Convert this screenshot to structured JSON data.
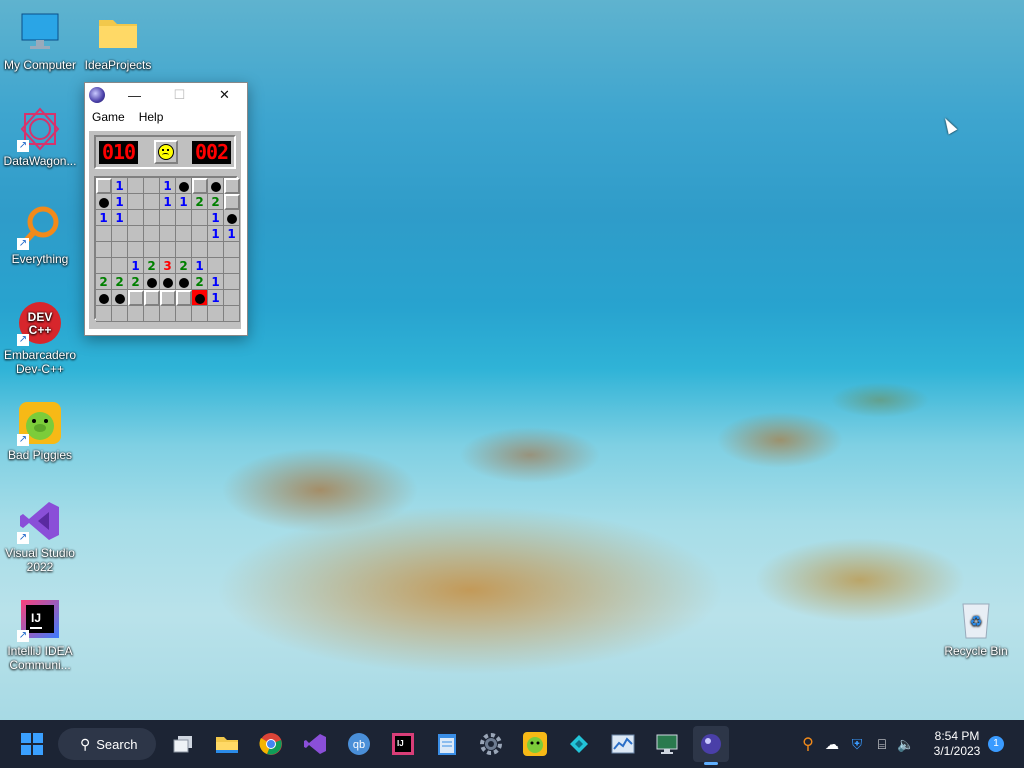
{
  "desktop": {
    "icons": [
      {
        "label": "My Computer"
      },
      {
        "label": "IdeaProjects"
      },
      {
        "label": "DataWagon..."
      },
      {
        "label": "Everything"
      },
      {
        "label": "Embarcadero Dev-C++"
      },
      {
        "label": "Bad Piggies"
      },
      {
        "label": "Visual Studio 2022"
      },
      {
        "label": "IntelliJ IDEA Communi..."
      },
      {
        "label": "Recycle Bin"
      }
    ]
  },
  "minesweeper": {
    "menu": {
      "game": "Game",
      "help": "Help"
    },
    "mine_counter": "010",
    "timer": "002",
    "face": "sad-face",
    "board": [
      [
        "H",
        "1",
        "",
        "",
        "1",
        "M",
        "H",
        "M",
        "H"
      ],
      [
        "M",
        "1",
        "",
        "",
        "1",
        "1",
        "2",
        "2",
        "H"
      ],
      [
        "1",
        "1",
        "",
        "",
        "",
        "",
        "",
        "1",
        "M"
      ],
      [
        "",
        "",
        "",
        "",
        "",
        "",
        "",
        "1",
        "1"
      ],
      [
        "",
        "",
        "",
        "",
        "",
        "",
        "",
        "",
        ""
      ],
      [
        "",
        "",
        "1",
        "2",
        "3",
        "2",
        "1",
        "",
        ""
      ],
      [
        "2",
        "2",
        "2",
        "M",
        "M",
        "M",
        "2",
        "1",
        ""
      ],
      [
        "M",
        "M",
        "H",
        "H",
        "H",
        "H",
        "X",
        "1",
        ""
      ]
    ]
  },
  "taskbar": {
    "search_label": "Search",
    "time": "8:54 PM",
    "date": "3/1/2023",
    "notification_count": "1",
    "colors": {
      "background": "#1c2434",
      "accent": "#3a9bff"
    }
  }
}
